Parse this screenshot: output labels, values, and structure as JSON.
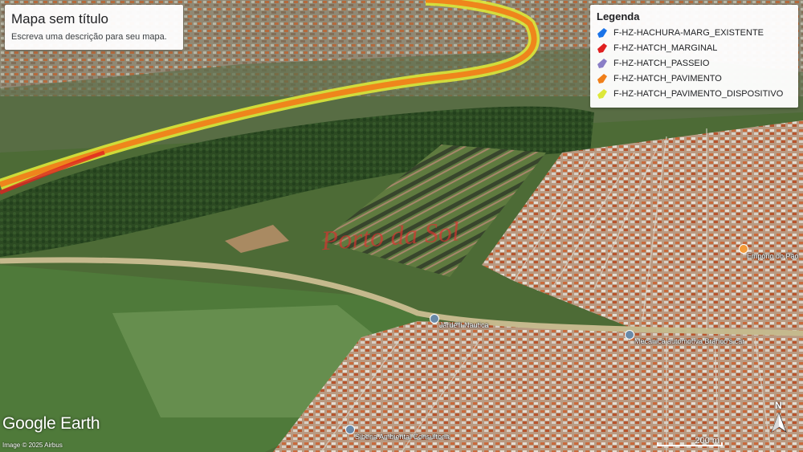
{
  "map": {
    "title": "Mapa sem título",
    "description": "Escreva uma descrição para seu mapa."
  },
  "legend": {
    "title": "Legenda",
    "items": [
      {
        "label": "F-HZ-HACHURA-MARG_EXISTENTE",
        "color": "#1a73e8"
      },
      {
        "label": "F-HZ-HATCH_MARGINAL",
        "color": "#e02020"
      },
      {
        "label": "F-HZ-HATCH_PASSEIO",
        "color": "#8a7fc7"
      },
      {
        "label": "F-HZ-HATCH_PAVIMENTO",
        "color": "#f07f1a"
      },
      {
        "label": "F-HZ-HATCH_PAVIMENTO_DISPOSITIVO",
        "color": "#dde83a"
      }
    ]
  },
  "places": [
    {
      "label": "Jardelli Nautica",
      "icon": "location-pin-icon",
      "pin_color": "#6a8aa8"
    },
    {
      "label": "Mecanica automotiva Branco's car",
      "icon": "location-pin-icon",
      "pin_color": "#6a8aa8"
    },
    {
      "label": "Empório do Pão",
      "icon": "location-pin-icon",
      "pin_color": "#f29b3a"
    },
    {
      "label": "Siberia Ambiental Consultoria",
      "icon": "location-pin-icon",
      "pin_color": "#6a8aa8"
    }
  ],
  "watermark": "Porto da Sol",
  "branding": {
    "logo": "Google Earth",
    "attribution": "Image © 2025 Airbus"
  },
  "scale": {
    "label": "200 m"
  },
  "compass": {
    "north_label": "N",
    "icon": "compass-north-arrow-icon"
  }
}
